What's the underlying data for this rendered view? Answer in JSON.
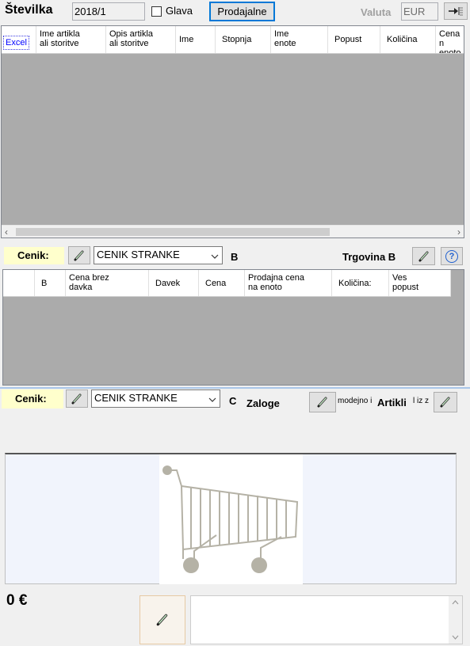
{
  "header": {
    "doc_label": "Številka",
    "doc_number": "2018/1",
    "glava_label": "Glava",
    "prodajalne_button": "Prodajalne",
    "valuta_label": "Valuta",
    "valuta_value": "EUR"
  },
  "grid1": {
    "columns": [
      "Excel",
      "Ime artikla\nali storitve",
      "Opis artikla\nali storitve",
      "Ime",
      "Stopnja",
      "Ime\nenote",
      "Popust",
      "Količina",
      "Cena n\nenoto"
    ]
  },
  "cenik_b": {
    "label": "Cenik:",
    "selected": "CENIK STRANKE",
    "letter": "B",
    "trgovina_label": "Trgovina B",
    "help_glyph": "?"
  },
  "grid2": {
    "columns": [
      "B",
      "Cena brez\ndavka",
      "Davek",
      "Cena",
      "Prodajna cena\nna enoto",
      "Količina:",
      "Ves\npopust"
    ]
  },
  "cenik_c": {
    "label": "Cenik:",
    "selected": "CENIK STRANKE",
    "letter": "C",
    "zaloge_label": "Zaloge",
    "modejno_text": "modejno i",
    "artikli_label": "Artikli",
    "iz_text": "l iz z"
  },
  "footer": {
    "total": "0 €"
  },
  "icons": {
    "pencil": "pencil-icon",
    "cart": "shopping-cart-icon",
    "arrow_in": "arrow-into-list-icon"
  },
  "colors": {
    "accent": "#0078d7",
    "grid_bg": "#ababab",
    "cenik_band": "#ffffcc"
  }
}
